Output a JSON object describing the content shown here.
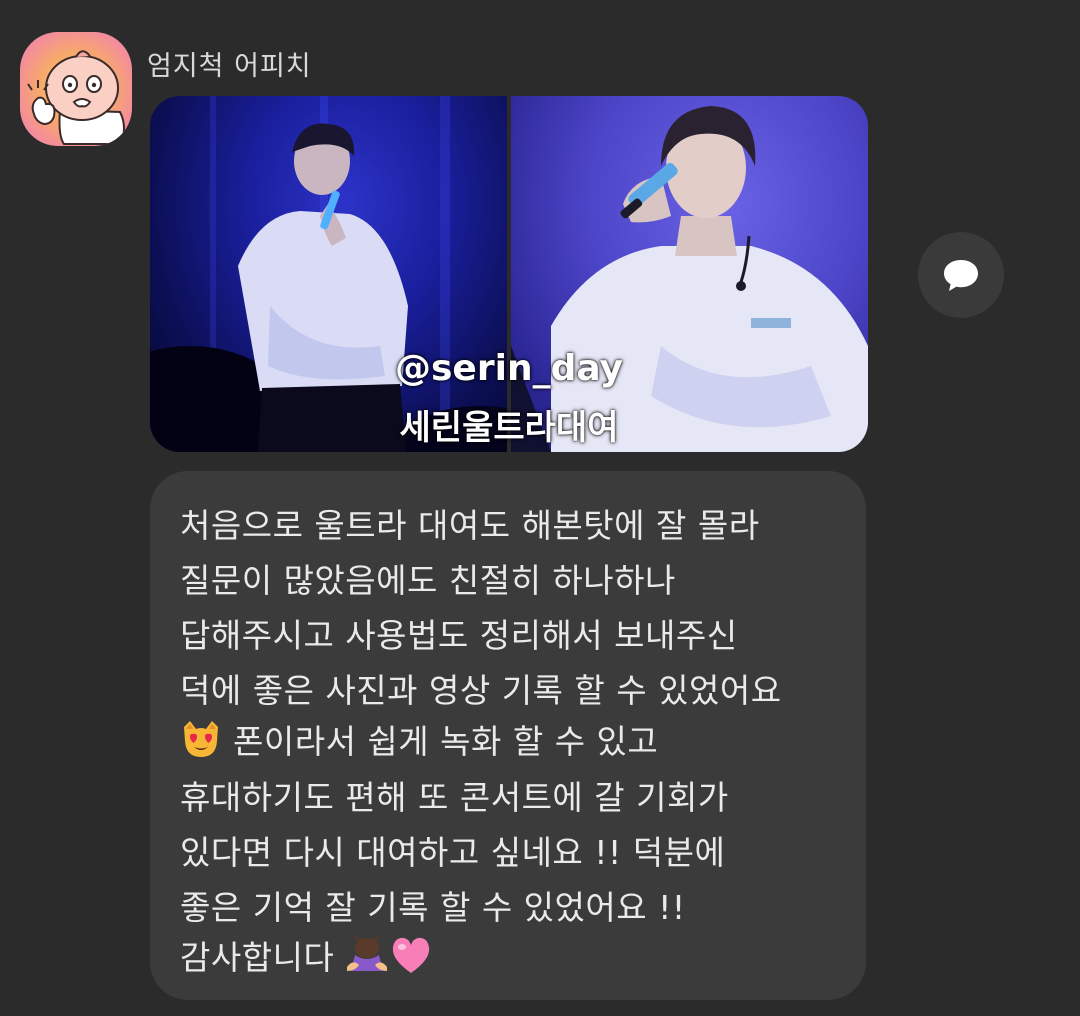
{
  "sender": {
    "name": "엄지척 어피치"
  },
  "photos": {
    "watermark_handle": "@serin_day",
    "watermark_name": "세린울트라대여"
  },
  "message": {
    "lines": [
      "처음으로 울트라 대여도 해본탓에 잘 몰라",
      "질문이 많았음에도 친절히 하나하나",
      "답해주시고 사용법도 정리해서 보내주신",
      "덕에 좋은 사진과 영상 기록 할 수 있었어요",
      " 폰이라서 쉽게 녹화 할 수 있고",
      "휴대하기도 편해 또 콘서트에 갈 기회가",
      "있다면 다시 대여하고 싶네요 !! 덕분에",
      "좋은 기억 잘 기록 할 수 있었어요 !!",
      "감사합니다 "
    ],
    "emojis": [
      "heart-eyes-cat",
      "person-bowing",
      "pink-heart"
    ]
  },
  "colors": {
    "background": "#2b2b2b",
    "bubble": "#3b3b3b",
    "text": "#eaeaea",
    "share_button": "#3a3a3a"
  }
}
